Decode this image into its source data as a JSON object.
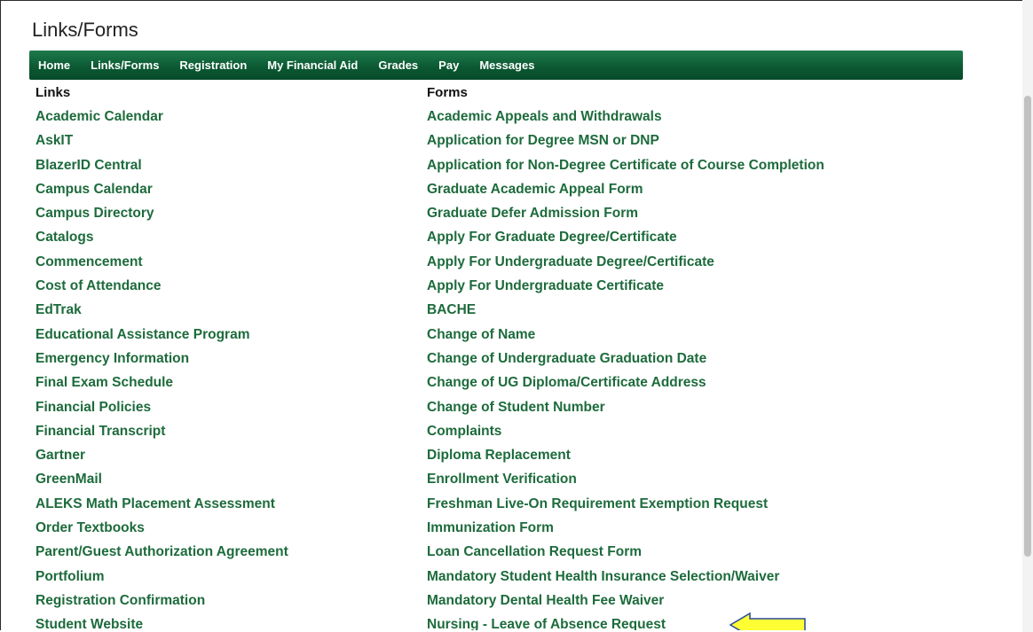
{
  "page": {
    "title": "Links/Forms"
  },
  "nav": {
    "items": [
      "Home",
      "Links/Forms",
      "Registration",
      "My Financial Aid",
      "Grades",
      "Pay",
      "Messages"
    ]
  },
  "links": {
    "header": "Links",
    "items": [
      "Academic Calendar",
      "AskIT",
      "BlazerID Central",
      "Campus Calendar",
      "Campus Directory",
      "Catalogs",
      "Commencement",
      "Cost of Attendance",
      "EdTrak",
      "Educational Assistance Program",
      "Emergency Information",
      "Final Exam Schedule",
      "Financial Policies",
      "Financial Transcript",
      "Gartner",
      "GreenMail",
      "ALEKS Math Placement Assessment",
      "Order Textbooks",
      "Parent/Guest Authorization Agreement",
      "Portfolium",
      "Registration Confirmation",
      "Student Website"
    ]
  },
  "forms": {
    "header": "Forms",
    "items": [
      "Academic Appeals and Withdrawals",
      "Application for Degree MSN or DNP",
      "Application for Non-Degree Certificate of Course Completion",
      "Graduate Academic Appeal Form",
      "Graduate Defer Admission Form",
      "Apply For Graduate Degree/Certificate",
      "Apply For Undergraduate Degree/Certificate",
      "Apply For Undergraduate Certificate",
      "BACHE",
      "Change of Name",
      "Change of Undergraduate Graduation Date",
      "Change of UG Diploma/Certificate Address",
      "Change of Student Number",
      "Complaints",
      "Diploma Replacement",
      "Enrollment Verification",
      "Freshman Live-On Requirement Exemption Request",
      "Immunization Form",
      "Loan Cancellation Request Form",
      "Mandatory Student Health Insurance Selection/Waiver",
      "Mandatory Dental Health Fee Waiver",
      "Nursing - Leave of Absence Request"
    ]
  },
  "annotation": {
    "icon": "left-arrow-icon",
    "fill_color": "#ffff33",
    "stroke_color": "#2a4aa0"
  },
  "colors": {
    "nav_bg": "#0b5a33",
    "link": "#1d6b3c"
  }
}
